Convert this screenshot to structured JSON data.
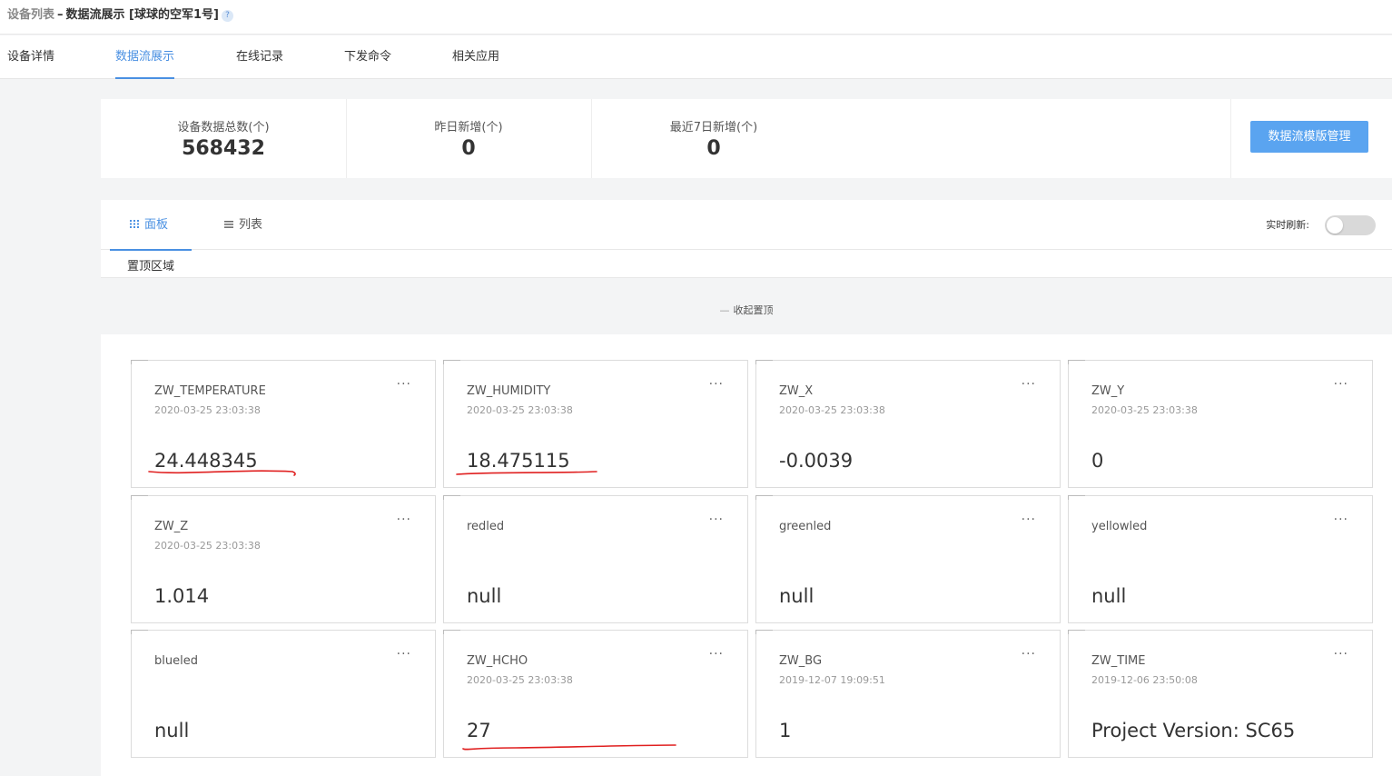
{
  "breadcrumb": {
    "root": "设备列表",
    "sep": "–",
    "current": "数据流展示 [球球的空军1号]",
    "help": "?"
  },
  "tabs": [
    "设备详情",
    "数据流展示",
    "在线记录",
    "下发命令",
    "相关应用"
  ],
  "active_tab": "数据流展示",
  "stats": [
    {
      "label": "设备数据总数(个)",
      "value": "568432"
    },
    {
      "label": "昨日新增(个)",
      "value": "0"
    },
    {
      "label": "最近7日新增(个)",
      "value": "0"
    }
  ],
  "template_button": "数据流模版管理",
  "view_tabs": {
    "panel": "面板",
    "list": "列表"
  },
  "realtime_label": "实时刷新:",
  "realtime_on": false,
  "pin": {
    "title": "置顶区域",
    "collapse": "收起置顶",
    "collapse_dash": "—"
  },
  "more_glyph": "···",
  "cards": [
    {
      "name": "ZW_TEMPERATURE",
      "time": "2020-03-25 23:03:38",
      "value": "24.448345"
    },
    {
      "name": "ZW_HUMIDITY",
      "time": "2020-03-25 23:03:38",
      "value": "18.475115"
    },
    {
      "name": "ZW_X",
      "time": "2020-03-25 23:03:38",
      "value": "-0.0039"
    },
    {
      "name": "ZW_Y",
      "time": "2020-03-25 23:03:38",
      "value": "0"
    },
    {
      "name": "ZW_Z",
      "time": "2020-03-25 23:03:38",
      "value": "1.014"
    },
    {
      "name": "redled",
      "time": "",
      "value": "null"
    },
    {
      "name": "greenled",
      "time": "",
      "value": "null"
    },
    {
      "name": "yellowled",
      "time": "",
      "value": "null"
    },
    {
      "name": "blueled",
      "time": "",
      "value": "null"
    },
    {
      "name": "ZW_HCHO",
      "time": "2020-03-25 23:03:38",
      "value": "27"
    },
    {
      "name": "ZW_BG",
      "time": "2019-12-07 19:09:51",
      "value": "1"
    },
    {
      "name": "ZW_TIME",
      "time": "2019-12-06 23:50:08",
      "value": "Project Version: SC65"
    }
  ],
  "colors": {
    "accent": "#4a90e2",
    "button": "#5aa4f0",
    "annotation": "#e02020"
  }
}
